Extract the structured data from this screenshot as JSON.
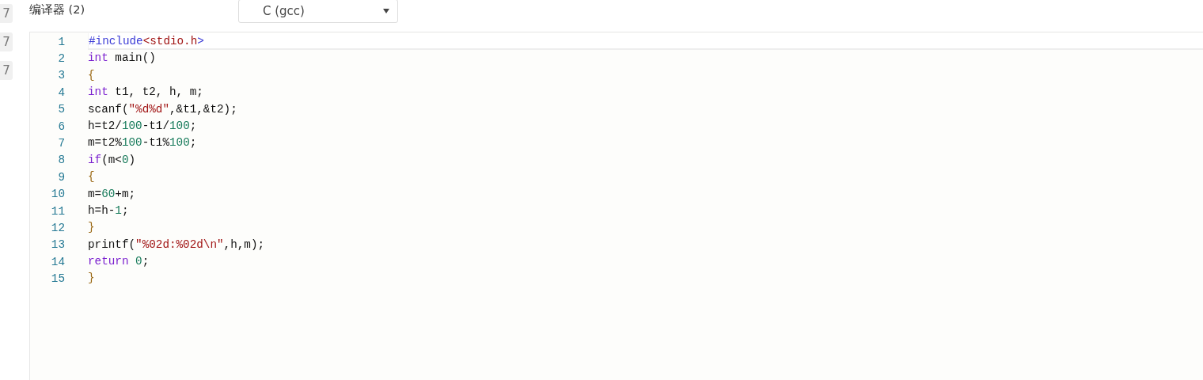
{
  "side_badges": [
    "7",
    "7",
    "7"
  ],
  "compiler": {
    "label": "编译器 (2)",
    "select_value": "C (gcc)"
  },
  "editor": {
    "lines": [
      {
        "number": "1",
        "active": true,
        "tokens": [
          {
            "kind": "meta",
            "text": "#include"
          },
          {
            "kind": "string",
            "text": "<stdio.h"
          },
          {
            "kind": "meta",
            "text": ">"
          }
        ]
      },
      {
        "number": "2",
        "active": false,
        "tokens": [
          {
            "kind": "keyword",
            "text": "int"
          },
          {
            "kind": "plain",
            "text": " main()"
          }
        ]
      },
      {
        "number": "3",
        "active": false,
        "tokens": [
          {
            "kind": "bracket",
            "text": "{"
          }
        ]
      },
      {
        "number": "4",
        "active": false,
        "tokens": [
          {
            "kind": "keyword",
            "text": "int"
          },
          {
            "kind": "plain",
            "text": " t1, t2, h, m;"
          }
        ]
      },
      {
        "number": "5",
        "active": false,
        "tokens": [
          {
            "kind": "plain",
            "text": "scanf("
          },
          {
            "kind": "string",
            "text": "\"%d%d\""
          },
          {
            "kind": "plain",
            "text": ",&t1,&t2);"
          }
        ]
      },
      {
        "number": "6",
        "active": false,
        "tokens": [
          {
            "kind": "plain",
            "text": "h=t2/"
          },
          {
            "kind": "number",
            "text": "100"
          },
          {
            "kind": "plain",
            "text": "-t1/"
          },
          {
            "kind": "number",
            "text": "100"
          },
          {
            "kind": "plain",
            "text": ";"
          }
        ]
      },
      {
        "number": "7",
        "active": false,
        "tokens": [
          {
            "kind": "plain",
            "text": "m=t2%"
          },
          {
            "kind": "number",
            "text": "100"
          },
          {
            "kind": "plain",
            "text": "-t1%"
          },
          {
            "kind": "number",
            "text": "100"
          },
          {
            "kind": "plain",
            "text": ";"
          }
        ]
      },
      {
        "number": "8",
        "active": false,
        "tokens": [
          {
            "kind": "keyword",
            "text": "if"
          },
          {
            "kind": "plain",
            "text": "(m<"
          },
          {
            "kind": "number",
            "text": "0"
          },
          {
            "kind": "plain",
            "text": ")"
          }
        ]
      },
      {
        "number": "9",
        "active": false,
        "tokens": [
          {
            "kind": "bracket",
            "text": "{"
          }
        ]
      },
      {
        "number": "10",
        "active": false,
        "tokens": [
          {
            "kind": "plain",
            "text": "m="
          },
          {
            "kind": "number",
            "text": "60"
          },
          {
            "kind": "plain",
            "text": "+m;"
          }
        ]
      },
      {
        "number": "11",
        "active": false,
        "tokens": [
          {
            "kind": "plain",
            "text": "h=h-"
          },
          {
            "kind": "number",
            "text": "1"
          },
          {
            "kind": "plain",
            "text": ";"
          }
        ]
      },
      {
        "number": "12",
        "active": false,
        "tokens": [
          {
            "kind": "bracket",
            "text": "}"
          }
        ]
      },
      {
        "number": "13",
        "active": false,
        "tokens": [
          {
            "kind": "plain",
            "text": "printf("
          },
          {
            "kind": "string",
            "text": "\"%02d:%02d\\n\""
          },
          {
            "kind": "plain",
            "text": ",h,m);"
          }
        ]
      },
      {
        "number": "14",
        "active": false,
        "tokens": [
          {
            "kind": "keyword",
            "text": "return"
          },
          {
            "kind": "number",
            "text": " 0"
          },
          {
            "kind": "plain",
            "text": ";"
          }
        ]
      },
      {
        "number": "15",
        "active": false,
        "tokens": [
          {
            "kind": "bracket",
            "text": "}"
          }
        ]
      }
    ]
  }
}
